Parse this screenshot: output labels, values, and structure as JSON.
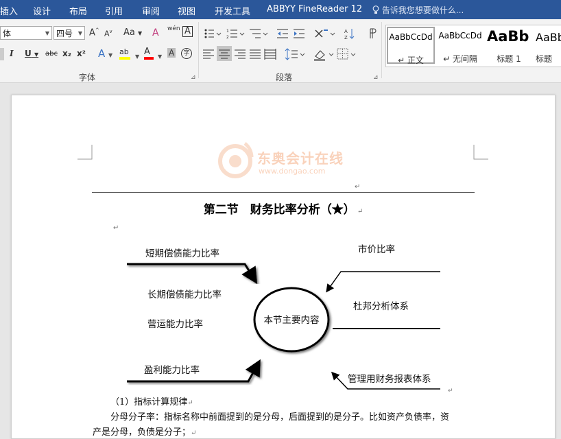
{
  "menubar": {
    "tabs": [
      "插入",
      "设计",
      "布局",
      "引用",
      "审阅",
      "视图",
      "开发工具",
      "ABBYY FineReader 12"
    ],
    "tell_me": "告诉我您想要做什么..."
  },
  "ribbon": {
    "font_name": "体",
    "font_size": "四号",
    "group_font": "字体",
    "group_paragraph": "段落",
    "buttons": {
      "grow": "A",
      "shrink": "A",
      "change_case": "Aa",
      "clear_format": "A",
      "phonetic": "wén",
      "char_border": "A",
      "italic": "I",
      "underline": "U",
      "strike": "abc",
      "subscript": "x₂",
      "superscript": "x²",
      "text_effects": "A",
      "highlight": "ab",
      "font_color": "A",
      "char_shading": "A",
      "enclose": "字"
    },
    "styles": [
      {
        "preview": "AaBbCcDd",
        "name": "↵ 正文"
      },
      {
        "preview": "AaBbCcDd",
        "name": "↵ 无间隔"
      },
      {
        "preview": "AaBb",
        "name": "标题 1"
      },
      {
        "preview": "AaBb",
        "name": "标题"
      }
    ]
  },
  "document": {
    "watermark_cn": "东奥会计在线",
    "watermark_url": "www.dongao.com",
    "section_title": "第二节　财务比率分析（★）",
    "diagram": {
      "center": "本节主要内容",
      "left_items": [
        "短期偿债能力比率",
        "长期偿债能力比率",
        "营运能力比率",
        "盈利能力比率"
      ],
      "right_items": [
        "市价比率",
        "杜邦分析体系",
        "管理用财务报表体系"
      ]
    },
    "para1": "（1）指标计算规律",
    "para2": "分母分子率：指标名称中前面提到的是分母，后面提到的是分子。比如资产负债率，资",
    "para3": "产是分母，负债是分子；"
  },
  "colors": {
    "ribbon_blue": "#2b579a",
    "highlight_yellow": "#ffff00",
    "font_red": "#ff0000"
  }
}
